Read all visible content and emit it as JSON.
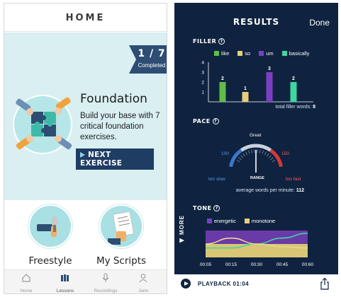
{
  "left": {
    "header_title": "HOME",
    "badge": {
      "count": "1 / 7",
      "label": "Completed"
    },
    "foundation": {
      "title": "Foundation",
      "description": "Build your base with 7 critical foundation exercises.",
      "button_label": "NEXT EXERCISE"
    },
    "modes": [
      {
        "label": "Freestyle",
        "icon": "microphone-icon"
      },
      {
        "label": "My Scripts",
        "icon": "script-icon"
      }
    ],
    "tabs": [
      {
        "label": "Home",
        "icon": "home-icon"
      },
      {
        "label": "Lessons",
        "icon": "lessons-icon",
        "active": true
      },
      {
        "label": "Recordings",
        "icon": "microphone-icon"
      },
      {
        "label": "Jane",
        "icon": "profile-icon"
      }
    ]
  },
  "right": {
    "title": "RESULTS",
    "done_label": "Done",
    "filler": {
      "label": "FILLER",
      "total_label": "total filler words:",
      "total_value": "8"
    },
    "pace": {
      "label": "PACE",
      "great": "Great",
      "low_value": "100",
      "high_value": "150",
      "too_slow": "too slow",
      "too_fast": "too fast",
      "range": "RANGE",
      "avg_label": "average words per minute:",
      "avg_value": "112",
      "needle_value": 112
    },
    "tone": {
      "label": "TONE",
      "legend": [
        {
          "name": "energetic",
          "color": "#7b3fc4"
        },
        {
          "name": "monotone",
          "color": "#e6cf7a"
        }
      ],
      "times": [
        "00:05",
        "00:15",
        "00:30",
        "00:45",
        "00:60"
      ]
    },
    "more_label": "MORE",
    "playback_label": "PLAYBACK 01:04"
  },
  "colors": {
    "navy": "#0f2340",
    "button": "#1f3c63",
    "hero_bg": "#d9eff2",
    "gauge_low": "#3a78c8",
    "gauge_high": "#d23a3a"
  },
  "chart_data": [
    {
      "type": "bar",
      "categories": [
        "like",
        "so",
        "um",
        "basically"
      ],
      "values": [
        2,
        1,
        3,
        2
      ],
      "colors": [
        "#5fbe46",
        "#e6cf7a",
        "#7b3fc4",
        "#3fd6a0"
      ],
      "ylim": [
        0,
        4
      ],
      "yticks": [
        1,
        2,
        3,
        4
      ],
      "grid": false,
      "legend": "top"
    },
    {
      "type": "area",
      "x": [
        "00:05",
        "00:15",
        "00:30",
        "00:45",
        "00:60"
      ],
      "series": [
        {
          "name": "energetic",
          "values": [
            0.35,
            0.35,
            0.5,
            0.72,
            0.9
          ]
        },
        {
          "name": "monotone",
          "values": [
            0.5,
            0.72,
            0.5,
            0.4,
            0.35
          ]
        }
      ],
      "grid": false,
      "legend": "top"
    }
  ]
}
